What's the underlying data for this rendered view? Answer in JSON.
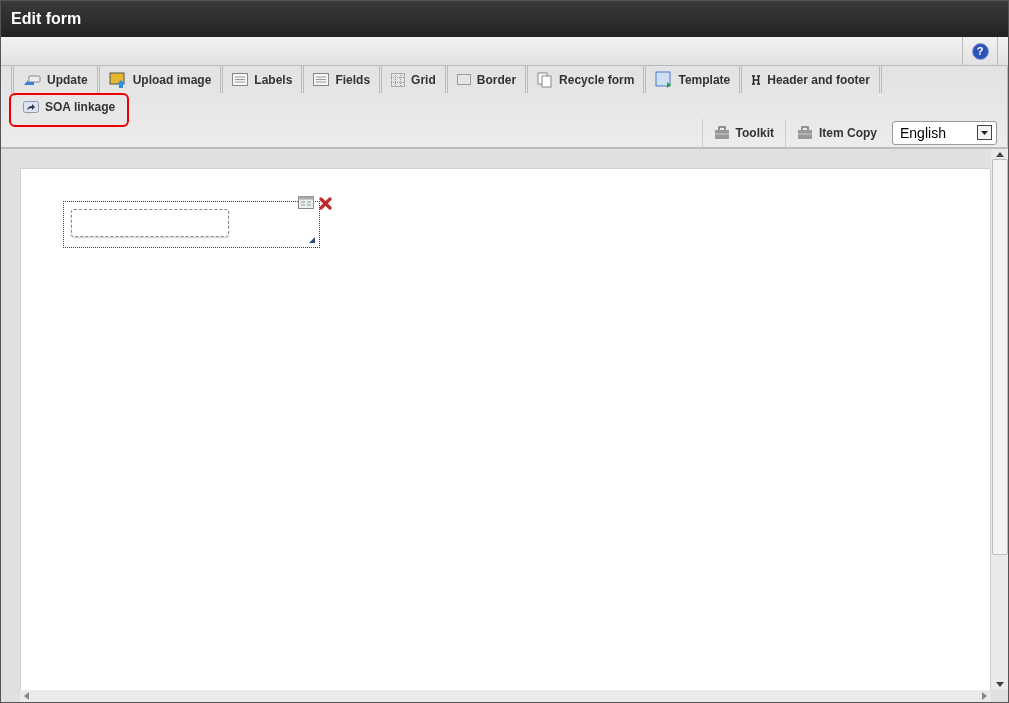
{
  "window": {
    "title": "Edit form"
  },
  "help": {
    "label": "?"
  },
  "toolbar": [
    {
      "label": "Update",
      "kind": "update",
      "highlighted": false
    },
    {
      "label": "Upload image",
      "kind": "image",
      "highlighted": false
    },
    {
      "label": "Labels",
      "kind": "list",
      "highlighted": false
    },
    {
      "label": "Fields",
      "kind": "list",
      "highlighted": false
    },
    {
      "label": "Grid",
      "kind": "grid",
      "highlighted": false
    },
    {
      "label": "Border",
      "kind": "border",
      "highlighted": false
    },
    {
      "label": "Recycle form",
      "kind": "pages",
      "highlighted": false
    },
    {
      "label": "Template",
      "kind": "template",
      "highlighted": false
    },
    {
      "label": "Header and footer",
      "kind": "header",
      "highlighted": false
    },
    {
      "label": "SOA linkage",
      "kind": "share",
      "highlighted": true
    }
  ],
  "tools": [
    {
      "label": "Toolkit"
    },
    {
      "label": "Item Copy"
    }
  ],
  "language": {
    "value": "English"
  }
}
